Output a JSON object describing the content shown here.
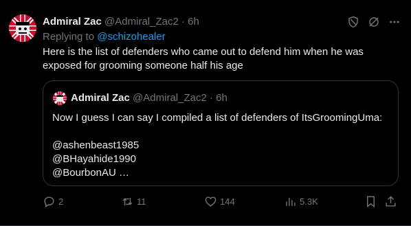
{
  "tweet": {
    "author_name": "Admiral Zac",
    "author_handle": "@Admiral_Zac2",
    "separator": "·",
    "time": "6h",
    "replying_prefix": "Replying to",
    "replying_to": "@schizohealer",
    "text": "Here is the list of defenders who came out to defend him when he was exposed for grooming someone half his age"
  },
  "quote": {
    "author_name": "Admiral Zac",
    "author_handle": "@Admiral_Zac2",
    "separator": "·",
    "time": "6h",
    "line1": "Now I guess I can say I compiled a list of defenders of ItsGroomingUma:",
    "line2": "@ashenbeast1985",
    "line3": "@BHayahide1990",
    "line4": "@BourbonAU …"
  },
  "actions": {
    "replies": "2",
    "reposts": "11",
    "likes": "144",
    "views": "5.3K"
  },
  "icons": [
    "shield-icon",
    "slash-icon",
    "more-icon",
    "reply-icon",
    "repost-icon",
    "like-icon",
    "views-icon",
    "bookmark-icon",
    "share-icon"
  ]
}
